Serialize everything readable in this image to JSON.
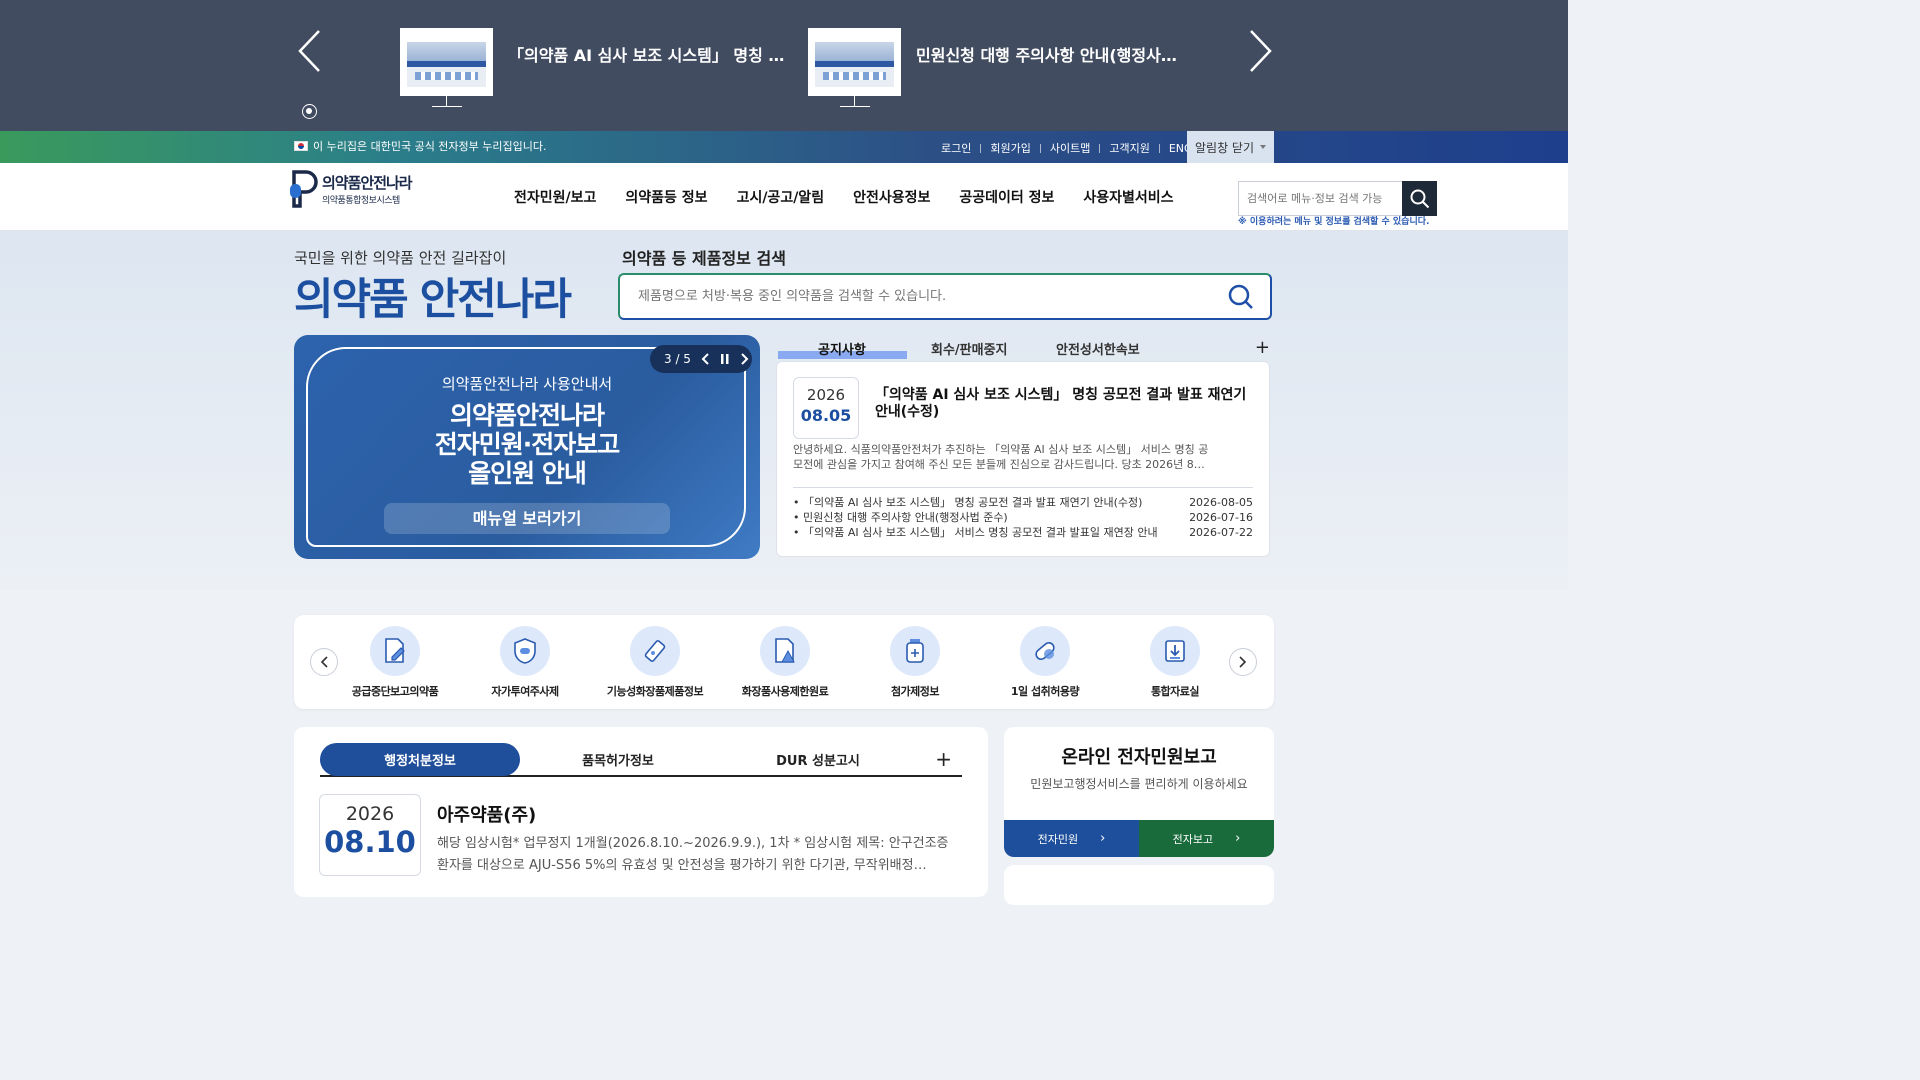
{
  "popup": {
    "items": [
      {
        "title": "「의약품 AI 심사 보조 시스템」 명칭 …"
      },
      {
        "title": "민원신청 대행 주의사항 안내(행정사…"
      }
    ]
  },
  "gov": {
    "notice": "이 누리집은 대한민국 공식 전자정부 누리집입니다.",
    "links": [
      "로그인",
      "회원가입",
      "사이트맵",
      "고객지원",
      "ENG"
    ],
    "close_label": "알림창 닫기"
  },
  "logo": {
    "name": "의약품안전나라",
    "sub": "의약품통합정보시스템"
  },
  "gnb": [
    "전자민원/보고",
    "의약품등 정보",
    "고시/공고/알림",
    "안전사용정보",
    "공공데이터 정보",
    "사용자별서비스"
  ],
  "header_search": {
    "placeholder": "검색어로 메뉴·정보 검색 가능",
    "hint": "※ 이용하려는 메뉴 및 정보를 검색할 수 있습니다."
  },
  "hero": {
    "sub": "국민을 위한 의약품 안전 길라잡이",
    "title": "의약품 안전나라",
    "search_title": "의약품 등 제품정보 검색",
    "search_placeholder": "제품명으로 처방·복용 중인 의약품을 검색할 수 있습니다."
  },
  "banner": {
    "counter": "3 / 5",
    "line1": "의약품안전나라 사용안내서",
    "line2": "의약품안전나라",
    "line3": "전자민원·전자보고",
    "line4": "올인원 안내",
    "button": "매뉴얼 보러가기"
  },
  "notice": {
    "tabs": [
      "공지사항",
      "회수/판매중지",
      "안전성서한속보"
    ],
    "more": "+",
    "featured": {
      "year": "2026",
      "md": "08.05",
      "title": "「의약품 AI 심사 보조 시스템」 명칭 공모전 결과 발표 재연기 안내(수정)",
      "desc": "안녕하세요. 식품의약품안전처가 추진하는 「의약품 AI 심사 보조 시스템」 서비스 명칭 공모전에 관심을 가지고 참여해 주신 모든 분들께 진심으로 감사드립니다. 당초 2026년 8…"
    },
    "list": [
      {
        "title": "「의약품 AI 심사 보조 시스템」 명칭 공모전 결과 발표 재연기 안내(수정)",
        "date": "2026-08-05"
      },
      {
        "title": "민원신청 대행 주의사항 안내(행정사법 준수)",
        "date": "2026-07-16"
      },
      {
        "title": "「의약품 AI 심사 보조 시스템」 서비스 명칭 공모전 결과 발표일 재연장 안내",
        "date": "2026-07-22"
      }
    ]
  },
  "quick": [
    {
      "label": "공급중단보고의약품",
      "icon": "document-edit-icon"
    },
    {
      "label": "자가투여주사제",
      "icon": "shield-pill-icon"
    },
    {
      "label": "기능성화장품제품정보",
      "icon": "cosmetic-tube-icon"
    },
    {
      "label": "화장품사용제한원료",
      "icon": "warning-document-icon"
    },
    {
      "label": "첨가제정보",
      "icon": "medicine-bottle-icon"
    },
    {
      "label": "1일 섭취허용량",
      "icon": "capsule-icon"
    },
    {
      "label": "통합자료실",
      "icon": "download-icon"
    }
  ],
  "admin": {
    "tabs": [
      "행정처분정보",
      "품목허가정보",
      "DUR 성분고시"
    ],
    "more": "+",
    "year": "2026",
    "md": "08.10",
    "title": "아주약품(주)",
    "desc": "해당 임상시험* 업무정지 1개월(2026.8.10.~2026.9.9.), 1차 * 임상시험 제목: 안구건조증 환자를 대상으로 AJU-S56 5%의 유효성 및 안전성을 평가하기 위한 다기관, 무작위배정…"
  },
  "online": {
    "title": "온라인 전자민원보고",
    "sub": "민원보고행정서비스를 편리하게 이용하세요",
    "btn1": "전자민원",
    "btn2": "전자보고"
  }
}
